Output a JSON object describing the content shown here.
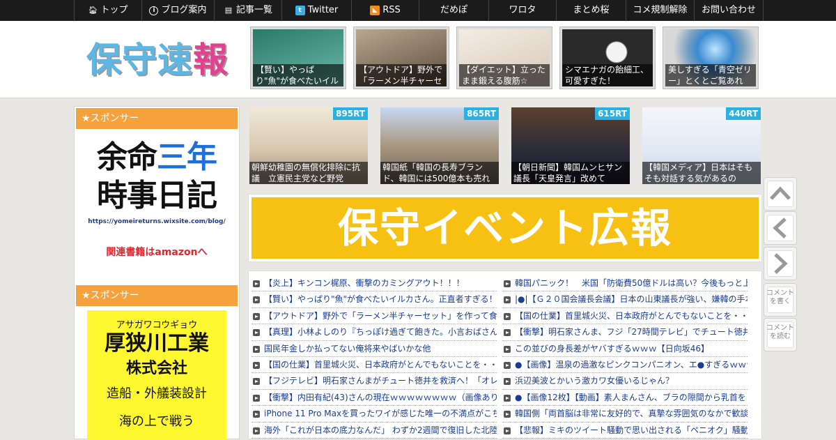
{
  "nav": {
    "items": [
      {
        "label": "トップ",
        "icon": "home-icon"
      },
      {
        "label": "ブログ案内",
        "icon": "info-icon"
      },
      {
        "label": "記事一覧",
        "icon": "list-icon"
      },
      {
        "label": "Twitter",
        "icon": "twitter-icon"
      },
      {
        "label": "RSS",
        "icon": "rss-icon"
      },
      {
        "label": "だめぽ"
      },
      {
        "label": "ワロタ"
      },
      {
        "label": "まとめ桜"
      },
      {
        "label": "コメ規制解除"
      },
      {
        "label": "お問い合わせ"
      }
    ]
  },
  "header": {
    "logo": {
      "c1": "保",
      "c2": "守",
      "c3": "速",
      "c4": "報"
    },
    "thumbs": [
      {
        "caption": "【賢い】やっぱり\"魚\"が食べたいイルカさん",
        "color": "#3a8c7a"
      },
      {
        "caption": "【アウトドア】野外で「ラーメン半チャーセット」",
        "color": "#7a6a58"
      },
      {
        "caption": "【ダイエット】立ったまま鍛える腹筋☆",
        "color": "#e8dcd0"
      },
      {
        "caption": "シマエナガの飴細工、可愛すぎた！",
        "color": "#3a3a3a"
      },
      {
        "caption": "美しすぎる「青空ゼリー」とくとご覧あれ",
        "color": "#5a9ad0"
      }
    ]
  },
  "sidebar": {
    "sponsor_label_1": "★スポンサー",
    "sponsor_label_2": "★スポンサー",
    "ad1": {
      "line1_a": "余命",
      "line1_b": "三年",
      "line2": "時事日記",
      "url": "https://yomeireturns.wixsite.com/blog/",
      "amazon": "関連書籍はamazonへ"
    },
    "ad2": {
      "kana": "アサガワコウギョウ",
      "name": "厚狭川工業",
      "suffix": "株式会社",
      "desc": "造船・外艤装設計",
      "extra": "海の上で戦う"
    }
  },
  "ranking": [
    {
      "rt": "895RT",
      "caption": "朝鮮幼稚園の無償化排除に抗議　立憲民主党など野党",
      "color": "#c8b8a0"
    },
    {
      "rt": "865RT",
      "caption": "韓国紙「韓国の長寿ブランド、韓国には500億本も売れ",
      "color": "#8a9ab0"
    },
    {
      "rt": "615RT",
      "caption": "【朝日新聞】韓国ムンヒサン議長「天皇発言」改めて",
      "color": "#2a2a3a"
    },
    {
      "rt": "440RT",
      "caption": "【韓国メディア】日本はそもそも対話する気があるの",
      "color": "#e8eef8"
    }
  ],
  "banner": {
    "text": "保守イベント広報"
  },
  "articles": {
    "left": [
      "【炎上】キンコン梶原、衝撃のカミングアウト！！！",
      "【賢い】やっぱり\"魚\"が食べたいイルカさん。正直者すぎる！",
      "【アウトドア】野外で「ラーメン半チャーセット」を作って食",
      "【真理】小林よしのり『ちっぽけ過ぎて飽きた。小言おばさん",
      "国民年金しか払ってない俺将来やばいかな他",
      "【国の仕業】首里城火災、日本政府がとんでもないことを・・",
      "【フジテレビ】明石家さんまがチュート徳井を救済へ！「オレ",
      "【衝撃】内田有紀(43)さんの現在ｗｗｗｗｗｗｗｗ（画像あり）",
      "iPhone 11 Pro Maxを買ったワイが感じた唯一の不満点がこちら",
      "海外「これが日本の底力なんだ」 わずか2週間で復旧した北陸"
    ],
    "right": [
      "韓国パニック！　米国「防衛費50億ドルは高い？今後もっと上",
      "|●|【Ｇ２０国会議長会議】日本の山東議長が強い、嫌韓の手本",
      "【国の仕業】首里城火災、日本政府がとんでもないことを・・",
      "【衝撃】明石家さんま、フジ「27時間テレビ」でチュート徳井",
      "この並びの身長差がヤバすぎるｗｗｗ【日向坂46】",
      "●【画像】温泉の過激なピンクコンパニオン、エ●すぎるｗｗｗ",
      "浜辺美波とかいう激カワ女優いるじゃん？",
      "●【画像12枚】【動画】素人まんさん、ブラの隙間から乳首を",
      "韓国側「両首脳は非常に友好的で、真摯な雰囲気のなかで歓談",
      "【悲報】ミキのツイート騒動で思い出される「ペニオク」騒動"
    ]
  },
  "float": {
    "comment_write": "コメントを書く",
    "comment_read": "コメントを読む"
  },
  "colors": {
    "accent_orange": "#f5a23c",
    "rt_blue": "#2ab1e3",
    "link_blue": "#1a3d8f",
    "banner_yellow": "#f7c113"
  }
}
